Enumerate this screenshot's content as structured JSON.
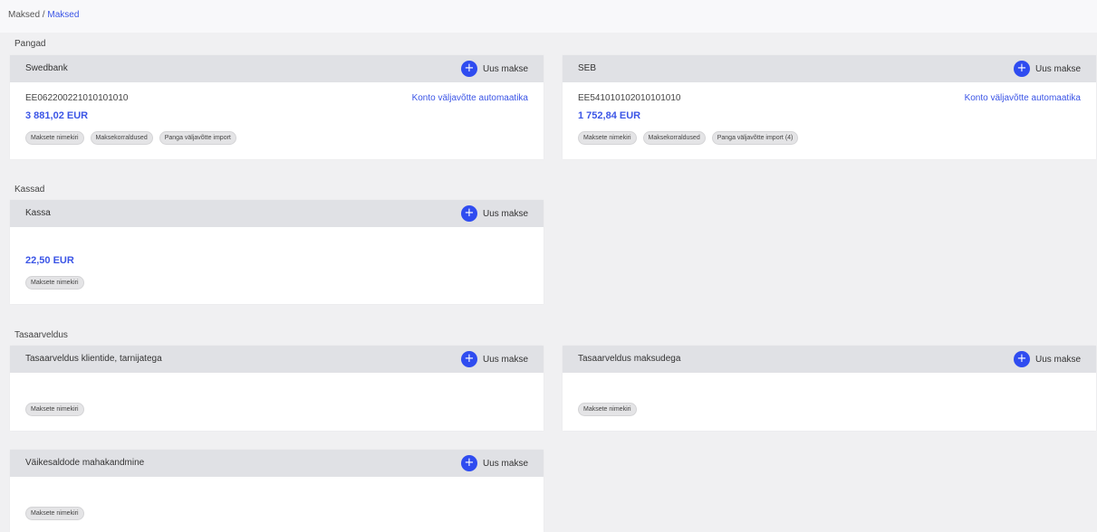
{
  "breadcrumb": {
    "parent": "Maksed",
    "separator": " / ",
    "current": "Maksed"
  },
  "sections": {
    "banks": "Pangad",
    "cash": "Kassad",
    "offset": "Tasaarveldus"
  },
  "new_payment_label": "Uus makse",
  "automation_link": "Konto väljavõtte automaatika",
  "cards": {
    "swedbank": {
      "title": "Swedbank",
      "account": "EE062200221010101010",
      "amount": "3 881,02 EUR",
      "tags": [
        "Maksete nimekiri",
        "Maksekorraldused",
        "Panga väljavõtte import"
      ]
    },
    "seb": {
      "title": "SEB",
      "account": "EE541010102010101010",
      "amount": "1 752,84 EUR",
      "tags": [
        "Maksete nimekiri",
        "Maksekorraldused",
        "Panga väljavõtte import (4)"
      ]
    },
    "kassa": {
      "title": "Kassa",
      "amount": "22,50 EUR",
      "tags": [
        "Maksete nimekiri"
      ]
    },
    "clients": {
      "title": "Tasaarveldus klientide, tarnijatega",
      "tags": [
        "Maksete nimekiri"
      ]
    },
    "taxes": {
      "title": "Tasaarveldus maksudega",
      "tags": [
        "Maksete nimekiri"
      ]
    },
    "writeoff": {
      "title": "Väikesaldode mahakandmine",
      "tags": [
        "Maksete nimekiri"
      ]
    }
  },
  "icons": {
    "new_payment": "plus-circle-icon"
  },
  "colors": {
    "accent": "#2f4cf0",
    "link": "#3b55e6",
    "card_header": "#e0e1e5",
    "background": "#f0f0f2"
  }
}
